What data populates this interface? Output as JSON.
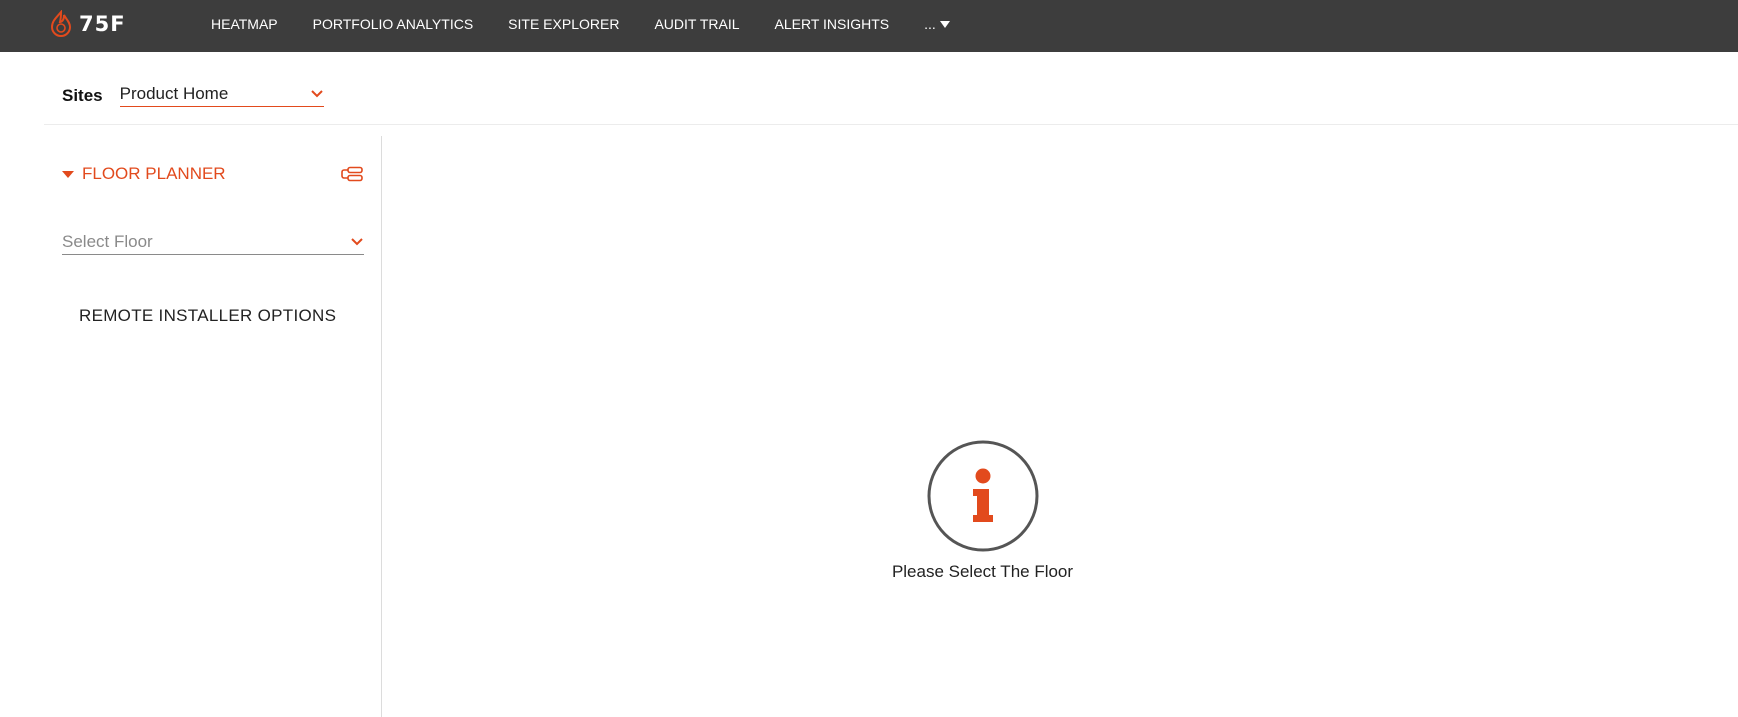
{
  "header": {
    "logo_text": "75F",
    "nav": [
      {
        "label": "HEATMAP"
      },
      {
        "label": "PORTFOLIO ANALYTICS"
      },
      {
        "label": "SITE EXPLORER"
      },
      {
        "label": "AUDIT TRAIL"
      },
      {
        "label": "ALERT INSIGHTS"
      }
    ],
    "more_label": "..."
  },
  "sites": {
    "label": "Sites",
    "selected": "Product Home"
  },
  "sidebar": {
    "floor_planner_title": "FLOOR PLANNER",
    "floor_select_placeholder": "Select Floor",
    "remote_installer_label": "REMOTE INSTALLER OPTIONS"
  },
  "main": {
    "empty_message": "Please Select The Floor"
  },
  "colors": {
    "accent": "#e24a1d",
    "topbar": "#3d3d3d"
  },
  "icons": [
    "logo-flame-icon",
    "chevron-down-icon",
    "caret-down-icon",
    "collapse-list-icon",
    "info-icon"
  ]
}
